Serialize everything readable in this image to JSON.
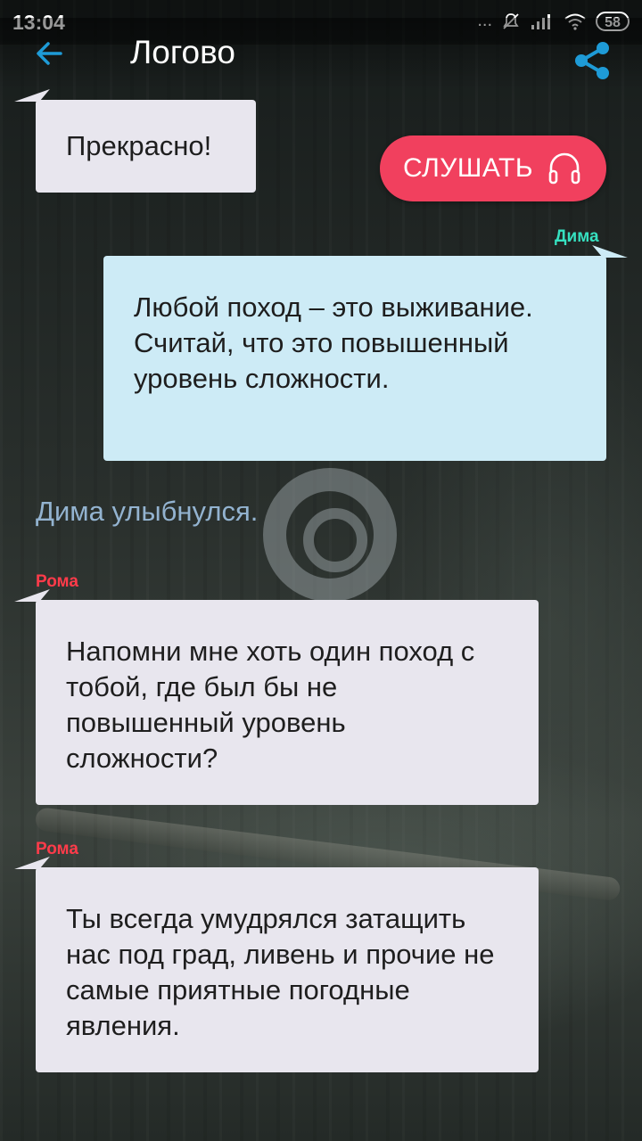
{
  "status_bar": {
    "time": "13:04",
    "dots": "...",
    "battery": "58"
  },
  "header": {
    "title": "Логово",
    "back_icon": "arrow-left-icon",
    "share_icon": "share-icon"
  },
  "listen_button": {
    "label": "СЛУШАТЬ",
    "icon": "headphones-icon",
    "color": "#f1405e"
  },
  "messages": [
    {
      "side": "left",
      "sender": "",
      "text": "Прекрасно!"
    },
    {
      "side": "right",
      "sender": "Дима",
      "sender_color": "#36e0c0",
      "text": "Любой поход – это выживание. Считай, что это повышенный уровень сложности."
    },
    {
      "side": "narration",
      "text": "Дима улыбнулся."
    },
    {
      "side": "left",
      "sender": "Рома",
      "sender_color": "#ff3b4a",
      "text": "Напомни мне хоть один поход с тобой, где был бы не повышенный уровень сложности?"
    },
    {
      "side": "left",
      "sender": "Рома",
      "sender_color": "#ff3b4a",
      "text": "Ты всегда умудрялся затащить нас под град, ливень и прочие не самые приятные погодные явления."
    }
  ],
  "colors": {
    "accent": "#1e9bd7",
    "left_bubble": "#e8e6ee",
    "right_bubble": "#cdebf6",
    "narration": "#93b3d0"
  }
}
